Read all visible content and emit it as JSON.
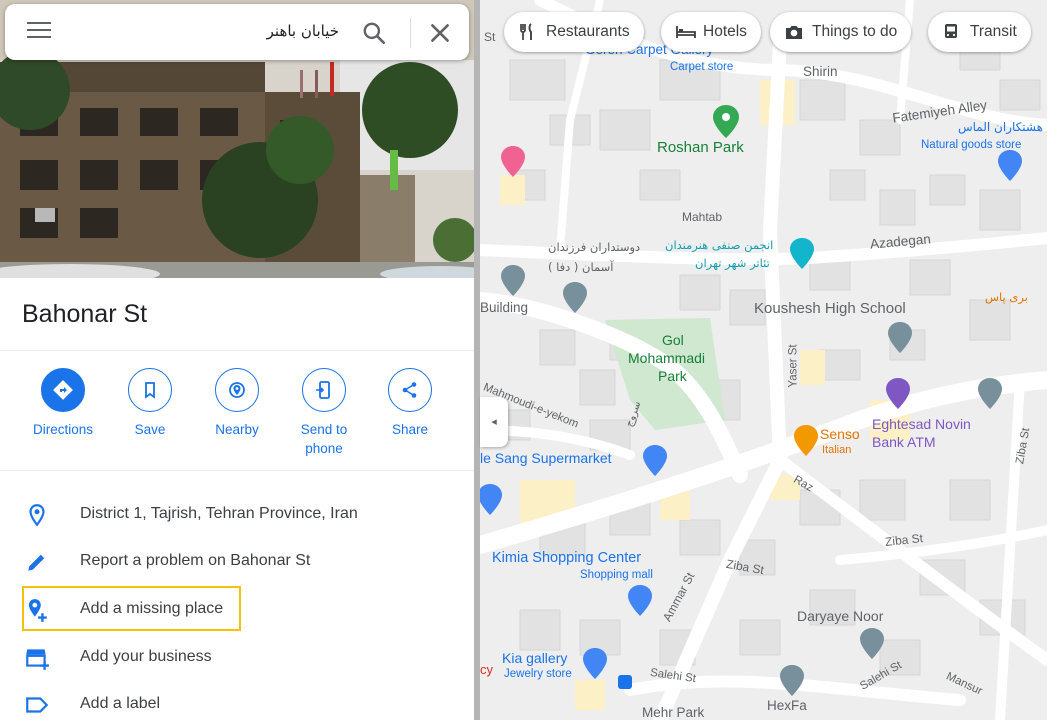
{
  "search": {
    "query": "خیابان باهنر"
  },
  "place": {
    "title": "Bahonar St"
  },
  "actions": [
    {
      "label": "Directions",
      "icon": "directions-icon"
    },
    {
      "label": "Save",
      "icon": "bookmark-icon"
    },
    {
      "label": "Nearby",
      "icon": "nearby-icon"
    },
    {
      "label": "Send to phone",
      "icon": "phone-icon"
    },
    {
      "label": "Share",
      "icon": "share-icon"
    }
  ],
  "info": [
    {
      "text": "District 1, Tajrish, Tehran Province, Iran",
      "icon": "location-pin-icon"
    },
    {
      "text": "Report a problem on Bahonar St",
      "icon": "pencil-icon"
    },
    {
      "text": "Add a missing place",
      "icon": "add-place-icon"
    },
    {
      "text": "Add your business",
      "icon": "store-icon"
    },
    {
      "text": "Add a label",
      "icon": "label-icon"
    }
  ],
  "chips": [
    {
      "label": "Restaurants",
      "icon": "fork-knife-icon"
    },
    {
      "label": "Hotels",
      "icon": "bed-icon"
    },
    {
      "label": "Things to do",
      "icon": "camera-icon"
    },
    {
      "label": "Transit",
      "icon": "bus-icon"
    }
  ],
  "map_labels": {
    "geren": "Geren Carpet Gallery",
    "carpet_store": "Carpet store",
    "shirin": "Shirin",
    "fatemiyeh": "Fatemiyeh Alley",
    "hashtkar": "هشتکاران الماس",
    "natural_goods": "Natural goods store",
    "roshan_park": "Roshan Park",
    "mahtab": "Mahtab",
    "azadegan": "Azadegan",
    "farzandan_1": "دوستداران فرزندان",
    "farzandan_2": "آسمان ( دفا )",
    "anjoman_1": "انجمن صنفی هنرمندان",
    "anjoman_2": "تئاتر شهر تهران",
    "building": "Building",
    "koushesh": "Koushesh High School",
    "bari": "بری پاس",
    "gol_1": "Gol",
    "gol_2": "Mohammadi",
    "gol_3": "Park",
    "yaser": "Yaser St",
    "mahmoudi": "Mahmoudi-e-yekom",
    "sorooj": "سروج",
    "senso": "Senso",
    "italian": "Italian",
    "eghtesad_1": "Eghtesad Novin",
    "eghtesad_2": "Bank ATM",
    "ziba_right": "Ziba St",
    "sang": "le Sang Supermarket",
    "raz": "Raz",
    "ziba_mid": "Ziba St",
    "ziba_low": "Ziba St",
    "kimia": "Kimia Shopping Center",
    "shopping_mall": "Shopping mall",
    "ammar": "Ammar St",
    "daryaye": "Daryaye Noor",
    "kia": "Kia gallery",
    "jewelry": "Jewelry store",
    "cy": "cy",
    "salehi_1": "Salehi St",
    "salehi_2": "Salehi St",
    "mansur": "Mansur",
    "hexfa": "HexFa",
    "mehr_park": "Mehr Park",
    "st_top": "St"
  },
  "colors": {
    "accent": "#1a73e8",
    "highlight": "#f4c20d",
    "park": "#c8e6c9",
    "map_bg": "#eeeeee"
  }
}
